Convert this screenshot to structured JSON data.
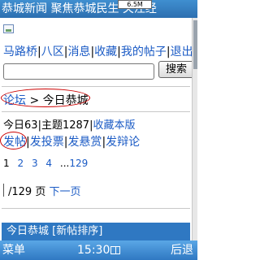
{
  "titlebar": {
    "title": "恭城新闻 聚焦恭城民生 关注经",
    "memory": "6.5M"
  },
  "nav": {
    "links": [
      {
        "label": "马路桥"
      },
      {
        "label": "八区"
      },
      {
        "label": "消息"
      },
      {
        "label": "收藏"
      },
      {
        "label": "我的帖子"
      },
      {
        "label": "退出"
      }
    ],
    "separator": "|"
  },
  "search": {
    "value": "",
    "button_label": "搜索"
  },
  "breadcrumb": {
    "root": "论坛",
    "arrow": ">",
    "current": "今日恭城"
  },
  "stats": {
    "today_label": "今日",
    "today_count": "63",
    "topics_label": "主题",
    "topics_count": "1287",
    "bookmark_board": "收藏本版"
  },
  "post_actions": {
    "new_post": "发帖",
    "vote": "发投票",
    "reward": "发悬赏",
    "debate": "发辩论",
    "separator": "|"
  },
  "pagination": {
    "pages": [
      "1",
      "2",
      "3",
      "4"
    ],
    "ellipsis": "...",
    "last": "129"
  },
  "jump": {
    "total": "/129",
    "unit": "页",
    "next": "下一页"
  },
  "section": {
    "title": "今日恭城 [新帖排序]"
  },
  "softkeys": {
    "left": "菜单",
    "time": "15:30",
    "right": "后退"
  }
}
